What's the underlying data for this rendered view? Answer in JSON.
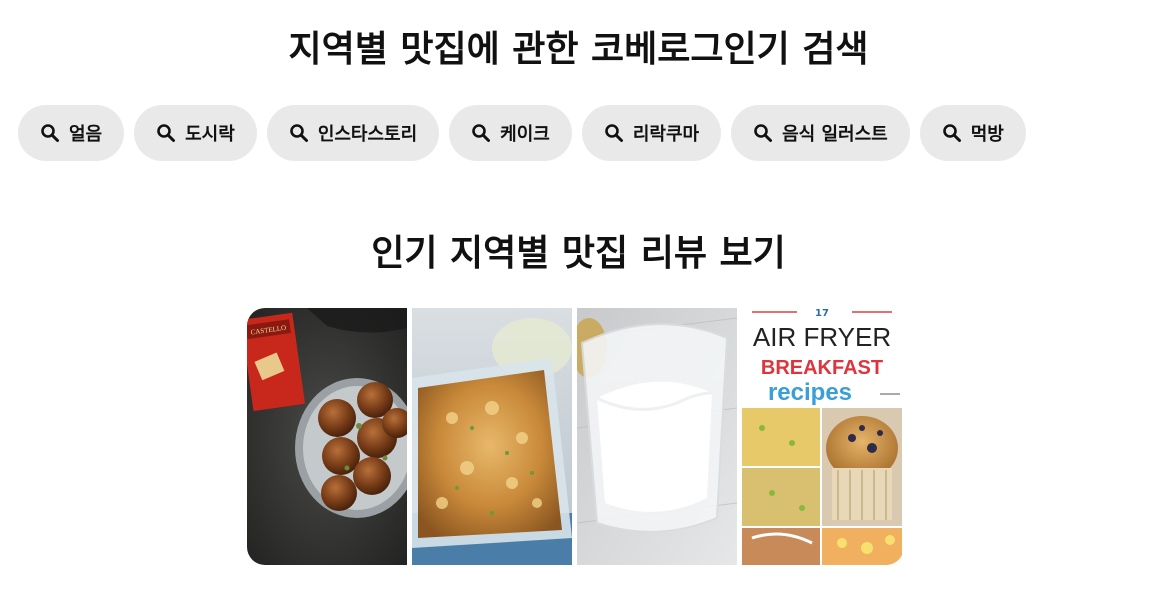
{
  "header": {
    "title": "지역별 맛집에 관한 코베로그인기 검색"
  },
  "search_chips": [
    {
      "label": "얼음",
      "icon": "search-icon"
    },
    {
      "label": "도시락",
      "icon": "search-icon"
    },
    {
      "label": "인스타스토리",
      "icon": "search-icon"
    },
    {
      "label": "케이크",
      "icon": "search-icon"
    },
    {
      "label": "리락쿠마",
      "icon": "search-icon"
    },
    {
      "label": "음식 일러스트",
      "icon": "search-icon"
    },
    {
      "label": "먹방",
      "icon": "search-icon"
    }
  ],
  "reviews": {
    "title": "인기 지역별 맛집 리뷰 보기",
    "images": [
      {
        "name": "meatballs-image",
        "text": "CASTELLO"
      },
      {
        "name": "casserole-image"
      },
      {
        "name": "yogurt-glass-image"
      },
      {
        "name": "air-fryer-breakfast-image",
        "lines": [
          "AIR FRYER",
          "BREAKFAST",
          "recipes"
        ]
      }
    ]
  },
  "colors": {
    "chip_bg": "#e9e9e9",
    "text": "#111111",
    "breakfast_red": "#e0343c",
    "recipes_blue": "#3a9ed8"
  }
}
